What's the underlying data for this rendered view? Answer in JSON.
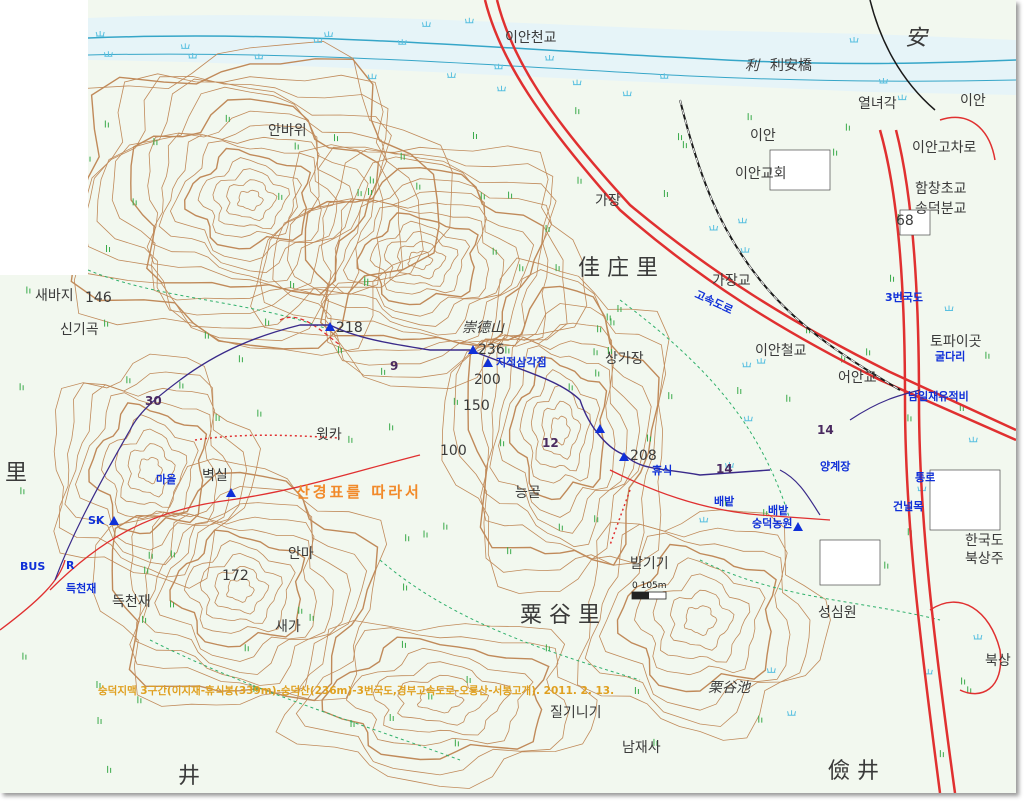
{
  "map": {
    "caption": "숭덕지맥 3구간(이지재-휴식봉(339m)-숭덕산(236m)-3번국도,경부고속도로-오룡산-서봉고개). 2011. 2. 13.",
    "trail_label": "산경표를 따라서",
    "scale_label": "0 105m",
    "places": [
      {
        "label": "이안천교"
      },
      {
        "label": "利"
      },
      {
        "label": "利安橋"
      },
      {
        "label": "安"
      },
      {
        "label": "열녀각"
      },
      {
        "label": "이안"
      },
      {
        "label": "이안교회"
      },
      {
        "label": "이안고차로"
      },
      {
        "label": "함창초교"
      },
      {
        "label": "송덕분교"
      },
      {
        "label": "가장"
      },
      {
        "label": "佳 庄 里"
      },
      {
        "label": "가장교"
      },
      {
        "label": "이안철교"
      },
      {
        "label": "어안교"
      },
      {
        "label": "토파이곳"
      },
      {
        "label": "안바위"
      },
      {
        "label": "새바지"
      },
      {
        "label": "신기곡"
      },
      {
        "label": "崇德山"
      },
      {
        "label": "상가장"
      },
      {
        "label": "윗카"
      },
      {
        "label": "능골"
      },
      {
        "label": "발기기"
      },
      {
        "label": "粟 谷 里"
      },
      {
        "label": "성심원"
      },
      {
        "label": "한국도"
      },
      {
        "label": "북상주"
      },
      {
        "label": "안마"
      },
      {
        "label": "새가"
      },
      {
        "label": "득천재"
      },
      {
        "label": "벽실"
      },
      {
        "label": "栗谷池"
      },
      {
        "label": "질기니기"
      },
      {
        "label": "남재사"
      },
      {
        "label": "儉 井"
      },
      {
        "label": "里"
      },
      {
        "label": "井"
      },
      {
        "label": "이안"
      },
      {
        "label": "북상"
      }
    ],
    "elevations": [
      "218",
      "236",
      "208",
      "146",
      "172",
      "200",
      "150",
      "100",
      "68"
    ],
    "annotations": [
      {
        "label": "지적삼각점"
      },
      {
        "label": "3번국도"
      },
      {
        "label": "고속도로"
      },
      {
        "label": "마을"
      },
      {
        "label": "SK"
      },
      {
        "label": "BUS"
      },
      {
        "label": "R"
      },
      {
        "label": "득천재"
      },
      {
        "label": "휴식"
      },
      {
        "label": "배밭"
      },
      {
        "label": "숭덕농원"
      },
      {
        "label": "배밭"
      },
      {
        "label": "양계장"
      },
      {
        "label": "남일재유적비"
      },
      {
        "label": "굴다리"
      },
      {
        "label": "통로"
      },
      {
        "label": "건널목"
      }
    ],
    "route_numbers": [
      "9",
      "30",
      "12",
      "14",
      "14"
    ],
    "colors": {
      "contour": "#c08a5a",
      "road": "#e03030",
      "river": "#36a6c8",
      "route": "#3a2a8a",
      "waypoint": "#1030d8",
      "trail_text": "#f28a2a",
      "grass": "#3aaa4a",
      "marsh": "#59c0e0"
    }
  }
}
